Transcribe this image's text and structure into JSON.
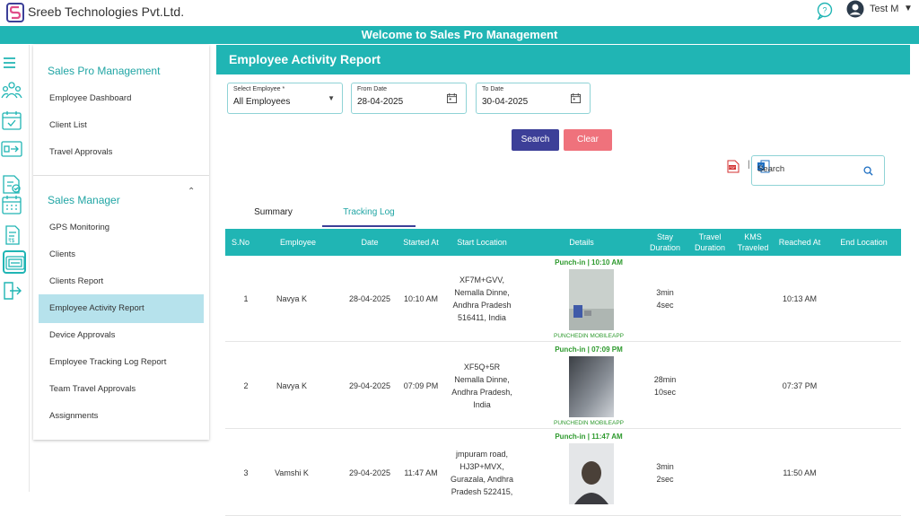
{
  "app": {
    "company": "Sreeb Technologies Pvt.Ltd.",
    "user": "Test M",
    "banner": "Welcome to Sales Pro Management"
  },
  "colors": {
    "accent": "#20b5b4",
    "primary": "#3c3f98",
    "danger": "#ef727c",
    "active_nav": "#b6e2ec",
    "punch": "#2e9a2e"
  },
  "rail_icons": [
    "menu-icon",
    "team-icon",
    "calendar-check-icon",
    "transfer-icon",
    "map-approval-icon",
    "calendar-grid-icon",
    "document-money-icon",
    "report-icon",
    "logout-icon"
  ],
  "sidebar": {
    "section1": "Sales Pro Management",
    "items1": [
      "Employee Dashboard",
      "Client List",
      "Travel Approvals"
    ],
    "section2": "Sales Manager",
    "items2": [
      "GPS Monitoring",
      "Clients",
      "Clients Report",
      "Employee Activity Report",
      "Device Approvals",
      "Employee Tracking Log Report",
      "Team Travel Approvals",
      "Assignments"
    ]
  },
  "report": {
    "title": "Employee Activity Report",
    "employee_label": "Select Employee *",
    "employee_value": "All Employees",
    "from_label": "From Date",
    "from_value": "28-04-2025",
    "to_label": "To Date",
    "to_value": "30-04-2025",
    "search_button": "Search",
    "clear_button": "Clear",
    "search_placeholder": "Search",
    "tabs": [
      "Summary",
      "Tracking Log"
    ],
    "columns": [
      "S.No",
      "Employee",
      "Date",
      "Started At",
      "Start Location",
      "Details",
      "Stay Duration",
      "Travel Duration",
      "KMS Traveled",
      "Reached At",
      "End Location"
    ],
    "rows": [
      {
        "sno": "1",
        "employee": "Navya K",
        "date": "28-04-2025",
        "started": "10:10 AM",
        "location": [
          "XF7M+GVV,",
          "Nemalla Dinne,",
          "Andhra Pradesh",
          "516411, India"
        ],
        "punch": "Punch-in | 10:10 AM",
        "source": "PUNCHEDIN MOBILEAPP",
        "stay": [
          "3min",
          "4sec"
        ],
        "travel": "",
        "kms": "",
        "reached": "10:13 AM",
        "end": ""
      },
      {
        "sno": "2",
        "employee": "Navya K",
        "date": "29-04-2025",
        "started": "07:09 PM",
        "location": [
          "XF5Q+5R",
          "Nemalla Dinne,",
          "Andhra Pradesh,",
          "India"
        ],
        "punch": "Punch-in | 07:09 PM",
        "source": "PUNCHEDIN MOBILEAPP",
        "stay": [
          "28min",
          "10sec"
        ],
        "travel": "",
        "kms": "",
        "reached": "07:37 PM",
        "end": ""
      },
      {
        "sno": "3",
        "employee": "Vamshi K",
        "date": "29-04-2025",
        "started": "11:47 AM",
        "location": [
          "jmpuram road,",
          "HJ3P+MVX,",
          "Gurazala, Andhra",
          "Pradesh 522415,"
        ],
        "punch": "Punch-in | 11:47 AM",
        "source": "",
        "stay": [
          "3min",
          "2sec"
        ],
        "travel": "",
        "kms": "",
        "reached": "11:50 AM",
        "end": ""
      }
    ]
  }
}
